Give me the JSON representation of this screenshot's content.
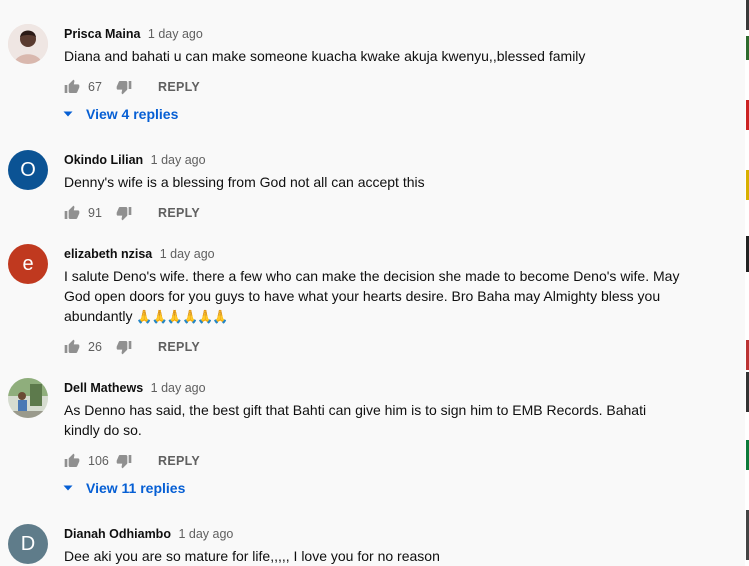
{
  "comments": [
    {
      "author": "Prisca Maina",
      "time": "1 day ago",
      "text": "Diana and bahati u can make someone kuacha kwake akuja kwenyu,,blessed family",
      "likes": "67",
      "reply_label": "REPLY",
      "view_replies": "View 4 replies",
      "avatar_color": "#c9a7a0"
    },
    {
      "author": "Okindo Lilian",
      "time": "1 day ago",
      "text": "Denny's wife is a blessing from God not all can accept this",
      "likes": "91",
      "reply_label": "REPLY",
      "avatar_letter": "O",
      "avatar_color": "#0b5394"
    },
    {
      "author": "elizabeth nzisa",
      "time": "1 day ago",
      "text": "I salute Deno's wife. there a few who can make the decision she made to become Deno's wife. May God open doors for you guys to have what your hearts desire. Bro Baha may Almighty bless you abundantly",
      "emoji": "🙏🙏🙏🙏🙏🙏",
      "likes": "26",
      "reply_label": "REPLY",
      "avatar_letter": "e",
      "avatar_color": "#c0391f"
    },
    {
      "author": "Dell Mathews",
      "time": "1 day ago",
      "text": "As Denno has said, the best gift that Bahti can give him is to sign him to EMB Records. Bahati kindly do so.",
      "likes": "106",
      "reply_label": "REPLY",
      "view_replies": "View 11 replies",
      "avatar_color": "#6f8f5f"
    },
    {
      "author": "Dianah Odhiambo",
      "time": "1 day ago",
      "text": "Dee aki you are so mature for life,,,,, I love you for no reason",
      "avatar_letter": "D",
      "avatar_color": "#5f7c8a"
    }
  ]
}
